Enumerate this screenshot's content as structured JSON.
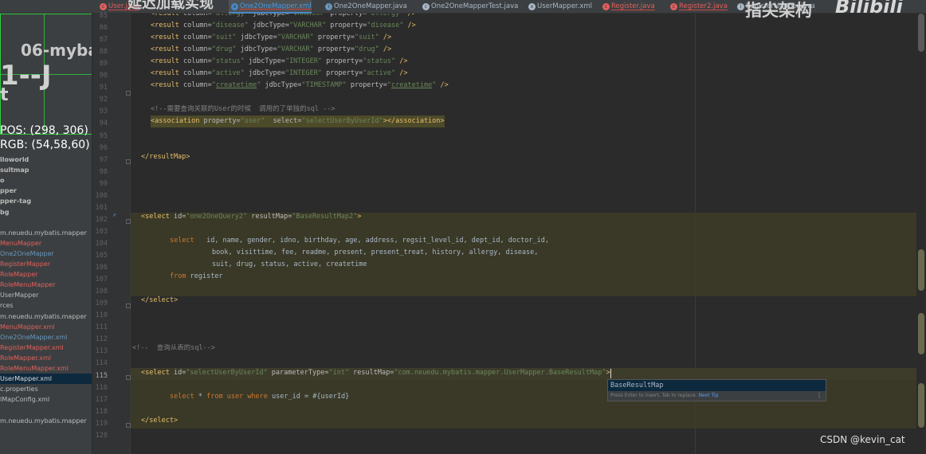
{
  "tabs": [
    {
      "label": "User.java",
      "icon": "class-icon",
      "color": "#e0605c"
    },
    {
      "label": "One2OneMapper.xml",
      "icon": "xml-icon",
      "color": "#4a88c7",
      "active": true
    },
    {
      "label": "One2OneMapper.java",
      "icon": "interface-icon",
      "color": "#6897bb"
    },
    {
      "label": "One2OneMapperTest.java",
      "icon": "class-icon",
      "color": "#a9b7c6"
    },
    {
      "label": "UserMapper.xml",
      "icon": "xml-icon",
      "color": "#a9b7c6"
    },
    {
      "label": "Register.java",
      "icon": "class-icon",
      "color": "#e0605c"
    },
    {
      "label": "Register2.java",
      "icon": "class-icon",
      "color": "#e0605c"
    },
    {
      "label": "RegisterMapper.java",
      "icon": "interface-icon",
      "color": "#a9b7c6"
    }
  ],
  "overlay": {
    "title_fragment": "06-myba",
    "big_text": "1--J",
    "big_text2": "t",
    "pos_label": "POS:",
    "pos_value": "(298, 306)",
    "rgb_label": "RGB:",
    "rgb_value": "(54,58,60)",
    "top_banner": "延迟加载实现"
  },
  "sidebar": {
    "items": [
      {
        "label": "lloworld",
        "bold": true,
        "color": "white"
      },
      {
        "label": "sultmap",
        "bold": true,
        "color": "white"
      },
      {
        "label": "o",
        "bold": true,
        "color": "white"
      },
      {
        "label": "pper",
        "bold": true,
        "color": "white"
      },
      {
        "label": "pper-tag",
        "bold": true,
        "color": "white"
      },
      {
        "label": "bg",
        "bold": true,
        "color": "white"
      },
      {
        "label": "",
        "bold": false,
        "color": "white"
      },
      {
        "label": "m.neuedu.mybatis.mapper",
        "bold": false,
        "color": "white"
      },
      {
        "label": "MenuMapper",
        "bold": false,
        "color": "red"
      },
      {
        "label": "One2OneMapper",
        "bold": false,
        "color": "blue"
      },
      {
        "label": "RegisterMapper",
        "bold": false,
        "color": "red"
      },
      {
        "label": "RoleMapper",
        "bold": false,
        "color": "red"
      },
      {
        "label": "RoleMenuMapper",
        "bold": false,
        "color": "red"
      },
      {
        "label": "UserMapper",
        "bold": false,
        "color": "white"
      },
      {
        "label": "rces",
        "bold": false,
        "color": "white"
      },
      {
        "label": "m.neuedu.mybatis.mapper",
        "bold": false,
        "color": "white"
      },
      {
        "label": "MenuMapper.xml",
        "bold": false,
        "color": "red"
      },
      {
        "label": "One2OneMapper.xml",
        "bold": false,
        "color": "blue"
      },
      {
        "label": "RegisterMapper.xml",
        "bold": false,
        "color": "red"
      },
      {
        "label": "RoleMapper.xml",
        "bold": false,
        "color": "red"
      },
      {
        "label": "RoleMenuMapper.xml",
        "bold": false,
        "color": "red"
      },
      {
        "label": "UserMapper.xml",
        "bold": false,
        "color": "sel",
        "selected": true
      },
      {
        "label": "c.properties",
        "bold": false,
        "color": "white"
      },
      {
        "label": "lMapConfig.xml",
        "bold": false,
        "color": "white"
      },
      {
        "label": "",
        "bold": false,
        "color": "white"
      },
      {
        "label": "m.neuedu.mybatis.mapper",
        "bold": false,
        "color": "white"
      }
    ]
  },
  "gutter": {
    "line_numbers": [
      "85",
      "86",
      "87",
      "88",
      "89",
      "90",
      "91",
      "92",
      "93",
      "94",
      "95",
      "96",
      "97",
      "98",
      "99",
      "100",
      "101",
      "102",
      "103",
      "104",
      "105",
      "106",
      "107",
      "108",
      "109",
      "110",
      "111",
      "112",
      "113",
      "114",
      "115",
      "116",
      "117",
      "118",
      "119",
      "120"
    ],
    "current_line": "115"
  },
  "code": {
    "l85": [
      "<result column=\"allergy\" jdbcType=\"VARCHAR\" property=\"allergy\" />"
    ],
    "l86": {
      "col": "disease",
      "type": "VARCHAR",
      "prop": "disease"
    },
    "l87": {
      "col": "suit",
      "type": "VARCHAR",
      "prop": "suit"
    },
    "l88": {
      "col": "drug",
      "type": "VARCHAR",
      "prop": "drug"
    },
    "l89": {
      "col": "status",
      "type": "INTEGER",
      "prop": "status"
    },
    "l90": {
      "col": "active",
      "type": "INTEGER",
      "prop": "active"
    },
    "l91": {
      "col": "createtime",
      "type": "TIMESTAMP",
      "prop": "createtime"
    },
    "comment93": "<!--需要查询关联的User的时候  调用的了单独的sql -->",
    "l94_property": "user",
    "l94_select": "selectUserByUserId",
    "l97": "</resultMap>",
    "l102_id": "one2OneQuery2",
    "l102_resultMap": "BaseResultMap2",
    "l104_select_kw": "select",
    "l104_cols": "id, name, gender, idno, birthday, age, address, regsit_level_id, dept_id, doctor_id,",
    "l105_cols": "book, visittime, fee, readme, present, present_treat, history, allergy, disease,",
    "l106_cols": "suit, drug, status, active, createtime",
    "l107_from": "from",
    "l107_table": "register",
    "l109": "</select>",
    "comment113": "<!--  查询从表的sql-->",
    "l115_id": "selectUserByUserId",
    "l115_param": "int",
    "l115_resultMap": "com.neuedu.mybatis.mapper.UserMapper.BaseResultMap",
    "l117_select": "select",
    "l117_star": "*",
    "l117_from": "from",
    "l117_table": "user",
    "l117_where": "where",
    "l117_col": "user_id",
    "l117_eq": "=",
    "l117_param": "#{userId}",
    "l119": "</select>"
  },
  "popup": {
    "suggestion": "BaseResultMap",
    "hint": "Press Enter to insert, Tab to replace.",
    "hint_link": "Next Tip",
    "more": "⋮"
  },
  "watermarks": {
    "brand_cn": "指尖架构",
    "bilibili": "Bilibili",
    "csdn": "CSDN @kevin_cat"
  }
}
